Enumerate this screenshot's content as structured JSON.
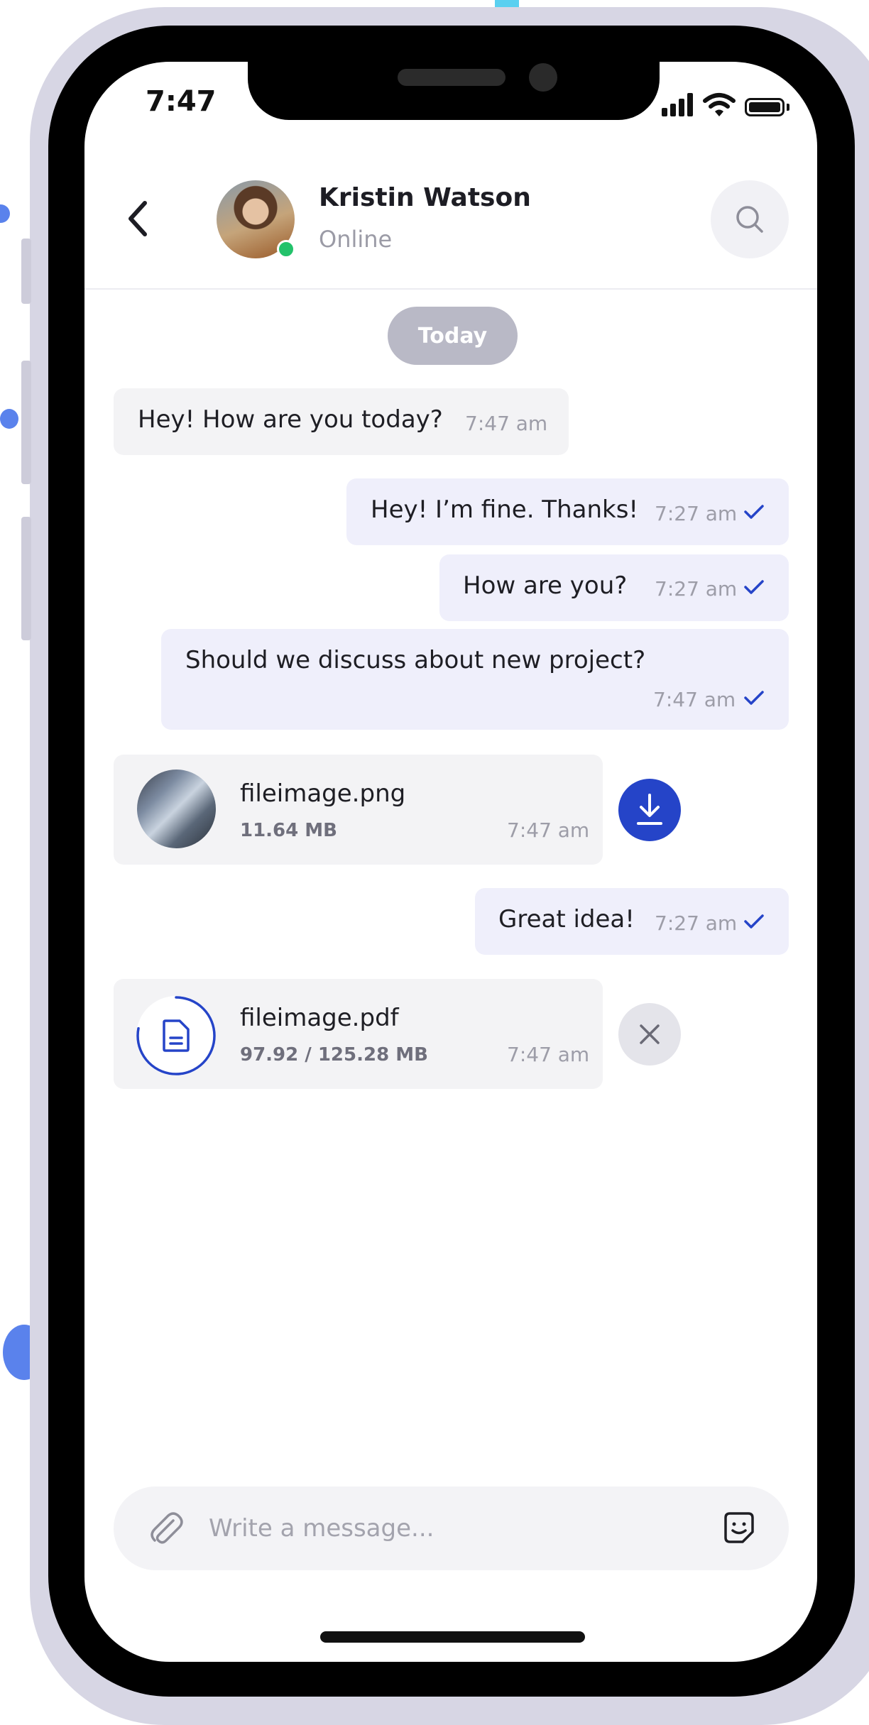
{
  "status_bar": {
    "time": "7:47"
  },
  "header": {
    "contact_name": "Kristin Watson",
    "contact_status": "Online"
  },
  "date_separator": "Today",
  "messages": [
    {
      "direction": "incoming",
      "text": "Hey! How are you today?",
      "time": "7:47 am"
    },
    {
      "direction": "outgoing",
      "text": "Hey! I’m fine. Thanks!",
      "time": "7:27 am",
      "read": true
    },
    {
      "direction": "outgoing",
      "text": "How are you?",
      "time": "7:27 am",
      "read": true
    },
    {
      "direction": "outgoing",
      "text": "Should we discuss about new project?",
      "time": "7:47 am",
      "read": true
    },
    {
      "direction": "incoming",
      "type": "file",
      "file_name": "fileimage.png",
      "file_size": "11.64 MB",
      "time": "7:47 am",
      "action": "download"
    },
    {
      "direction": "outgoing",
      "text": "Great idea!",
      "time": "7:27 am",
      "read": true
    },
    {
      "direction": "incoming",
      "type": "file",
      "file_name": "fileimage.pdf",
      "file_size": "97.92 / 125.28 MB",
      "time": "7:47 am",
      "action": "cancel",
      "progress": 0.78
    }
  ],
  "composer": {
    "placeholder": "Write a message..."
  },
  "icons": {
    "back": "chevron-left-icon",
    "search": "search-icon",
    "download": "download-icon",
    "cancel": "close-icon",
    "attach": "paperclip-icon",
    "sticker": "sticker-smile-icon",
    "document": "document-icon"
  },
  "colors": {
    "accent": "#2544c8",
    "online": "#23c26b",
    "incoming_bubble": "#f3f3f5",
    "outgoing_bubble": "#efeffb",
    "date_pill": "#b9b9c6"
  }
}
